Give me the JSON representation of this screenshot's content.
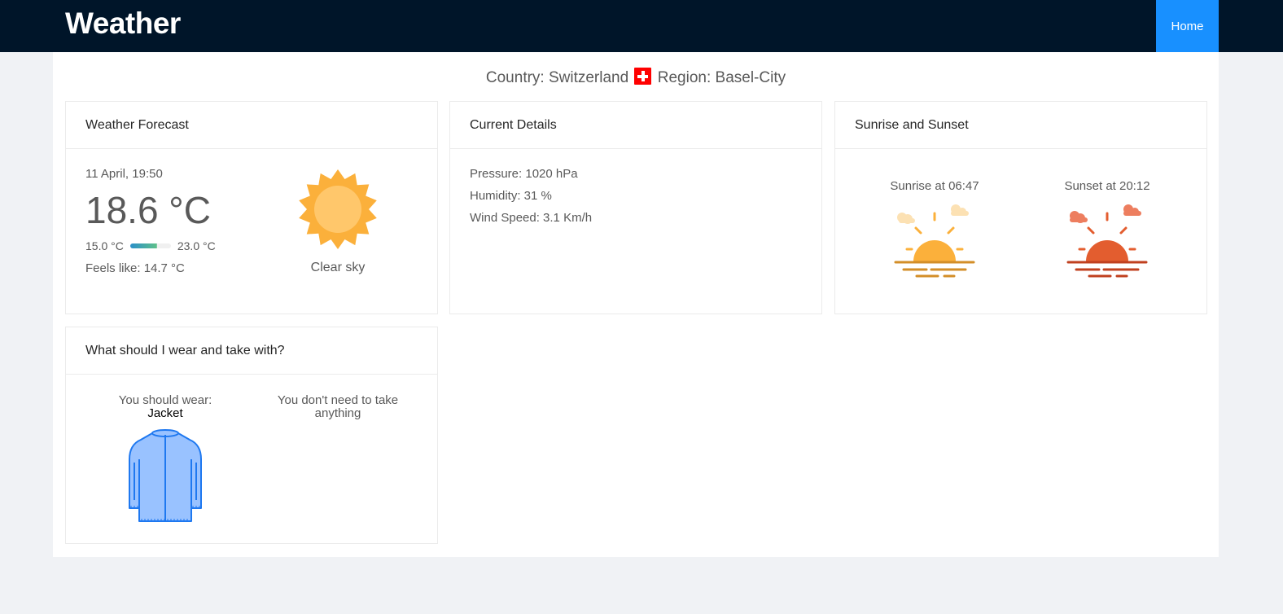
{
  "app": {
    "title": "Weather",
    "nav_home": "Home"
  },
  "location": {
    "country_label": "Country: Switzerland",
    "region_label": "Region: Basel-City"
  },
  "forecast": {
    "title": "Weather Forecast",
    "datetime": "11 April, 19:50",
    "temperature": "18.6 °C",
    "min_temp": "15.0 °C",
    "max_temp": "23.0 °C",
    "feels_like": "Feels like: 14.7 °C",
    "condition": "Clear sky",
    "icon": "sun-icon"
  },
  "details": {
    "title": "Current Details",
    "pressure": "Pressure: 1020 hPa",
    "humidity": "Humidity: 31 %",
    "wind": "Wind Speed: 3.1 Km/h"
  },
  "sun": {
    "title": "Sunrise and Sunset",
    "sunrise": "Sunrise at 06:47",
    "sunset": "Sunset at 20:12",
    "sunrise_icon": "sunrise-icon",
    "sunset_icon": "sunset-icon"
  },
  "wear": {
    "title": "What should I wear and take with?",
    "wear_label": "You should wear:",
    "wear_item": "Jacket",
    "take_label": "You don't need to take anything",
    "icon": "jacket-icon"
  },
  "colors": {
    "header_bg": "#001529",
    "nav_active": "#1890ff",
    "sun": "#fbb03b",
    "sunset": "#e35d2f",
    "jacket": "#99c2ff"
  }
}
